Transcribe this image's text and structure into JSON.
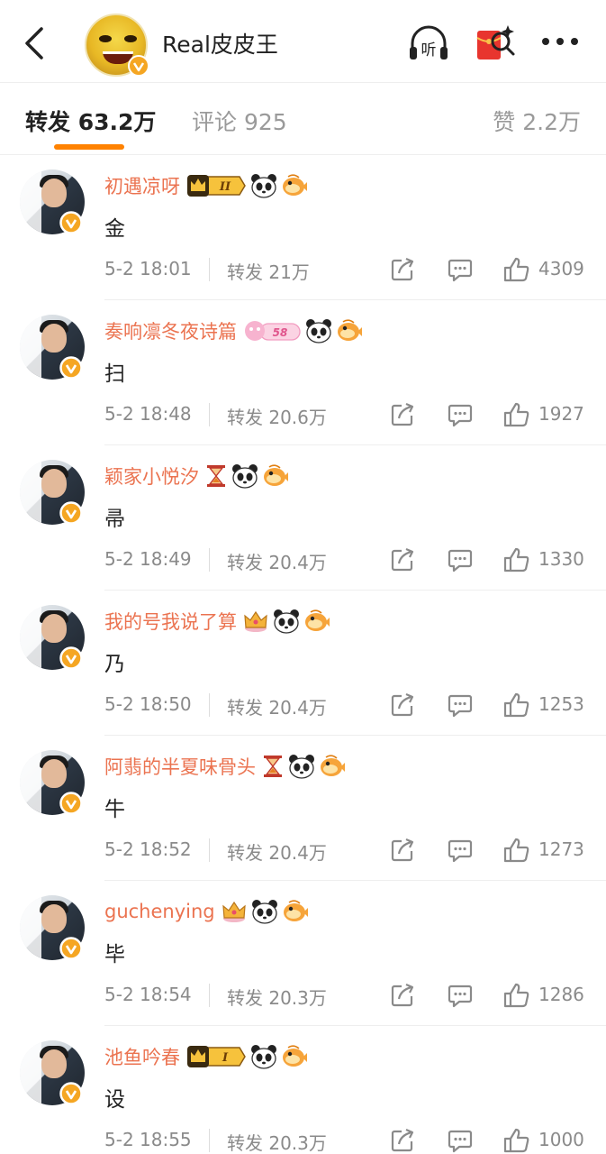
{
  "header": {
    "back_icon": "chevron-left-icon",
    "title": "Real皮皮王",
    "listen_label": "听",
    "verified_color": "#f5a623",
    "accent": "#ff8200",
    "red_packet_color": "#e8352e"
  },
  "tabs": [
    {
      "label": "转发 63.2万",
      "active": true
    },
    {
      "label": "评论 925",
      "active": false
    },
    {
      "label": "赞 2.2万",
      "active": false
    }
  ],
  "items": [
    {
      "name": "初遇凉呀",
      "badge_text": "II",
      "badges": [
        "crown-badge-II",
        "panda-icon",
        "puffer-fish-icon"
      ],
      "comment": "金",
      "time": "5-2 18:01",
      "repost": "转发 21万",
      "likes": "4309"
    },
    {
      "name": "奏响凛冬夜诗篇",
      "badge_text": "58",
      "badges": [
        "pink-level-badge",
        "panda-icon",
        "puffer-fish-icon"
      ],
      "comment": "扫",
      "time": "5-2 18:48",
      "repost": "转发 20.6万",
      "likes": "1927"
    },
    {
      "name": "颖家小悦汐",
      "badges": [
        "hourglass-icon",
        "panda-icon",
        "puffer-fish-icon"
      ],
      "comment": "帚",
      "time": "5-2 18:49",
      "repost": "转发 20.4万",
      "likes": "1330"
    },
    {
      "name": "我的号我说了算",
      "badges": [
        "gold-crown-icon",
        "panda-icon",
        "puffer-fish-icon"
      ],
      "comment": "乃",
      "time": "5-2 18:50",
      "repost": "转发 20.4万",
      "likes": "1253"
    },
    {
      "name": "阿翡的半夏味骨头",
      "badges": [
        "hourglass-icon",
        "panda-icon",
        "puffer-fish-icon"
      ],
      "comment": "牛",
      "time": "5-2 18:52",
      "repost": "转发 20.4万",
      "likes": "1273"
    },
    {
      "name": "guchenying",
      "badges": [
        "gold-crown-icon",
        "panda-icon",
        "puffer-fish-icon"
      ],
      "comment": "毕",
      "time": "5-2 18:54",
      "repost": "转发 20.3万",
      "likes": "1286"
    },
    {
      "name": "池鱼吟春",
      "badge_text": "I",
      "badges": [
        "crown-badge-I",
        "panda-icon",
        "puffer-fish-icon"
      ],
      "comment": "设",
      "time": "5-2 18:55",
      "repost": "转发 20.3万",
      "likes": "1000"
    }
  ]
}
